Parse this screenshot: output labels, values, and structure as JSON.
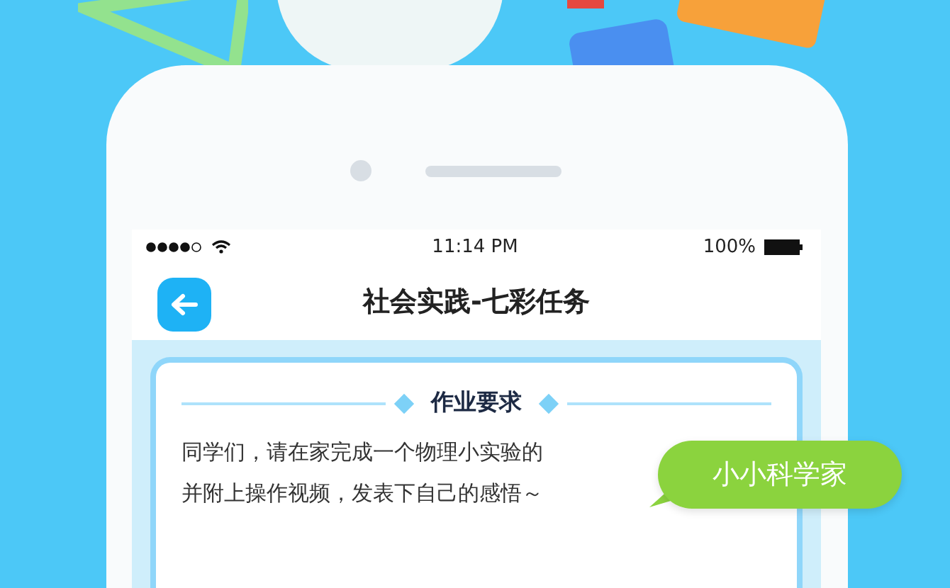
{
  "status_bar": {
    "time": "11:14 PM",
    "battery": "100%"
  },
  "nav_bar": {
    "title": "社会实践-七彩任务"
  },
  "card": {
    "heading": "作业要求",
    "lines": [
      "同学们，请在家完成一个物理小实验的",
      "并附上操作视频，发表下自己的感悟～"
    ]
  },
  "bubble": {
    "label": "小小科学家"
  }
}
